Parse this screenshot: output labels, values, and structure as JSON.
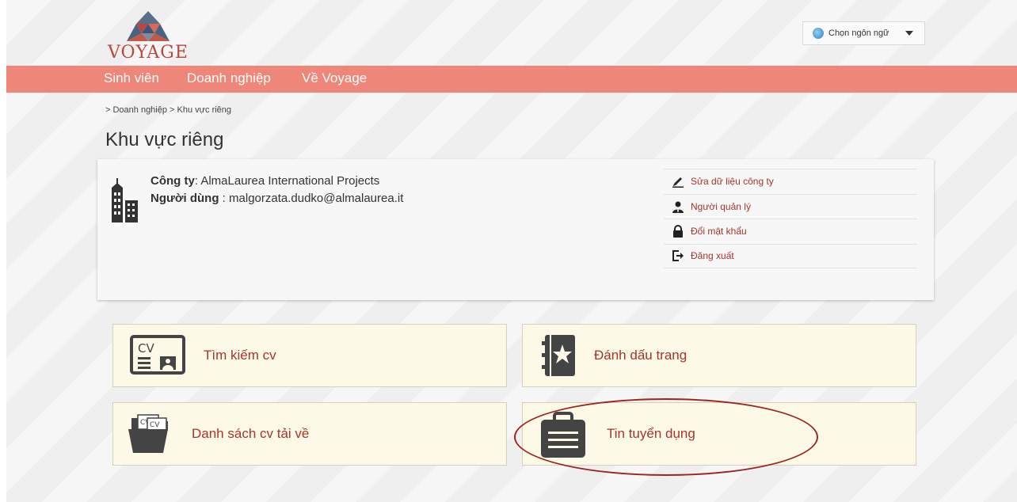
{
  "header": {
    "logo_text": "VOYAGE",
    "language_selector": {
      "label": "Chọn ngôn ngữ"
    }
  },
  "nav": {
    "items": [
      {
        "label": "Sinh viên"
      },
      {
        "label": "Doanh nghiệp"
      },
      {
        "label": "Về Voyage"
      }
    ]
  },
  "breadcrumb": "> Doanh nghiệp > Khu vực riêng",
  "page_title": "Khu vực riêng",
  "profile": {
    "company_label": "Công ty",
    "company_value": ": AlmaLaurea International Projects",
    "user_label": "Người dùng",
    "user_value": " : malgorzata.dudko@almalaurea.it",
    "actions": [
      {
        "label": "Sửa dữ liệu công ty",
        "icon": "pencil-icon"
      },
      {
        "label": "Người quản lý",
        "icon": "manager-icon"
      },
      {
        "label": "Đổi mật khẩu",
        "icon": "lock-icon"
      },
      {
        "label": "Đăng xuất",
        "icon": "logout-icon"
      }
    ]
  },
  "tiles": {
    "search_cv": "Tìm kiếm cv",
    "bookmark": "Đánh dấu trang",
    "downloaded_cv": "Danh sách cv tải về",
    "job_posts": "Tin tuyển dụng"
  },
  "colors": {
    "nav_bg": "#ee8679",
    "accent_text": "#a8342a",
    "tile_bg": "#fdf9e7",
    "highlight": "#9b2520"
  }
}
